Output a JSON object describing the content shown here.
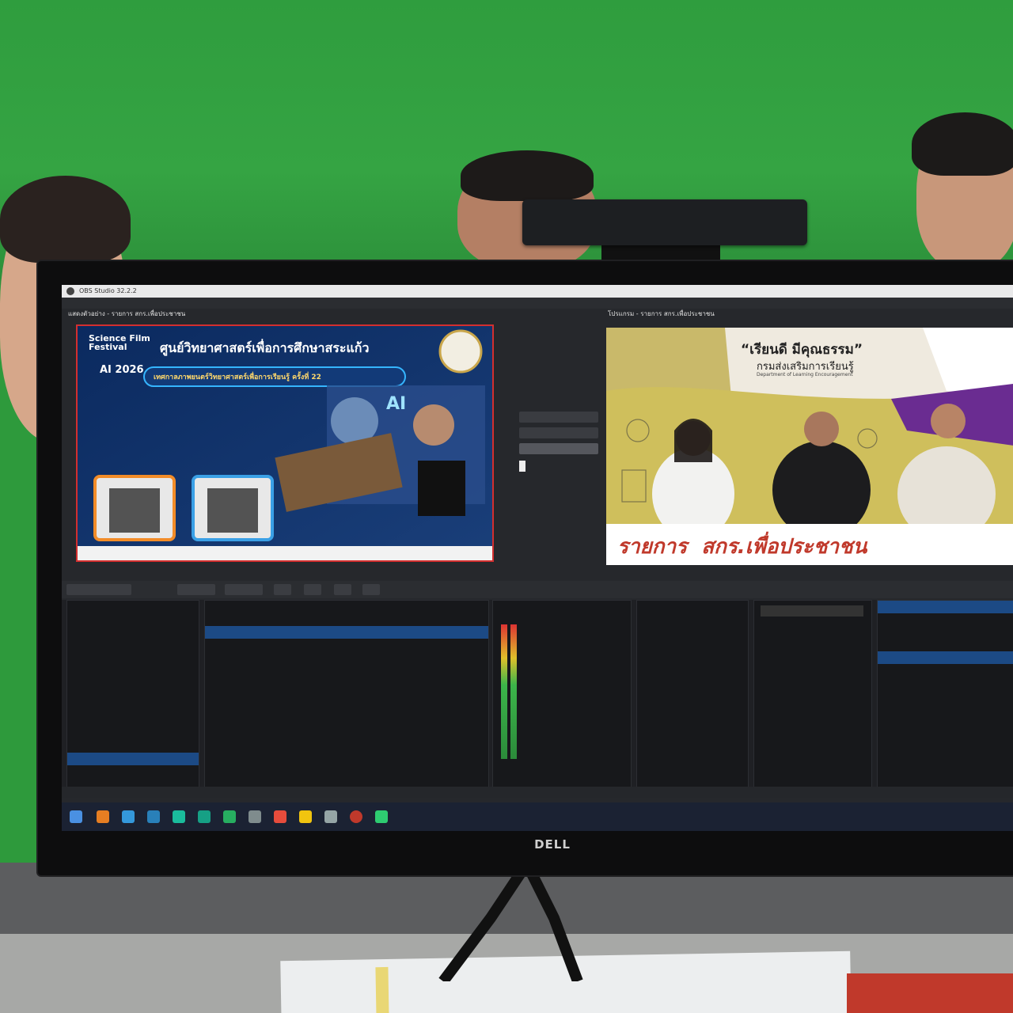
{
  "obs": {
    "app_title": "OBS Studio 32.2.2",
    "preview_title": "แสดงตัวอย่าง - รายการ สกร.เพื่อประชาชน",
    "program_title": "โปรแกรม - รายการ สกร.เพื่อประชาชน"
  },
  "preview_poster": {
    "festival_logo": "Science Film Festival",
    "festival_year_logo": "AI 2026",
    "heading": "ศูนย์วิทยาศาสตร์เพื่อการศึกษาสระแก้ว",
    "subheading": "เทศกาลภาพยนตร์วิทยาศาสตร์เพื่อการเรียนรู้ ครั้งที่ 22",
    "badge": "AI"
  },
  "program_banner": {
    "slogan": "“เรียนดี มีคุณธรรม”",
    "department_th": "กรมส่งเสริมการเรียนรู้",
    "department_en": "Department of Learning Encouragement",
    "lower_third": "รายการ  สกร.เพื่อประชาชน"
  },
  "colors": {
    "green_screen": "#2f9d3e",
    "obs_bg": "#26282c",
    "accent_red": "#d32f2f",
    "program_purple": "#6a2c91",
    "lower_third_text": "#c0392b"
  },
  "monitor": {
    "brand": "DELL"
  }
}
